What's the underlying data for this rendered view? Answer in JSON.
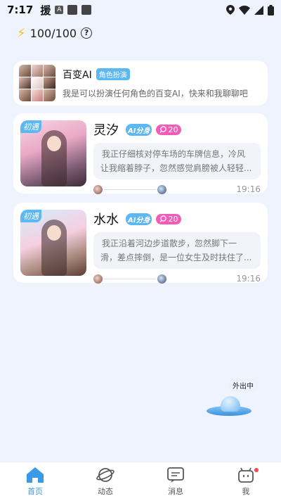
{
  "status_bar": {
    "time": "7:17",
    "app_char": "援",
    "a_icon": "A"
  },
  "energy": {
    "value": "100/100",
    "help": "?"
  },
  "ai_card": {
    "name": "百变AI",
    "badge": "角色扮演",
    "desc": "我是可以扮演任何角色的百变AI，快来和我聊聊吧"
  },
  "characters": [
    {
      "tag": "初遇",
      "name": "灵汐",
      "ai_badge": "AI分身",
      "count": "20",
      "line1": "我正仔细核对停车场的车牌信息，冷风",
      "line2": "让我缩着脖子，忽然感觉肩膀被人轻轻...",
      "time": "19:16"
    },
    {
      "tag": "初遇",
      "name": "水水",
      "ai_badge": "AI分身",
      "count": "20",
      "line1": "我正沿着河边步道散步，忽然脚下一",
      "line2": "滑，差点摔倒，是一位女生及时扶住了...",
      "time": "19:16"
    }
  ],
  "outing": {
    "label": "外出中"
  },
  "nav": {
    "items": [
      {
        "label": "首页",
        "icon": "home-icon",
        "active": true
      },
      {
        "label": "动态",
        "icon": "planet-icon",
        "active": false
      },
      {
        "label": "消息",
        "icon": "message-icon",
        "active": false
      },
      {
        "label": "我",
        "icon": "robot-icon",
        "active": false
      }
    ]
  },
  "colors": {
    "accent": "#3a9ae8",
    "badge_blue": "#5cb8f2",
    "badge_pink": "#f25bb6",
    "energy": "#f3c21a"
  }
}
